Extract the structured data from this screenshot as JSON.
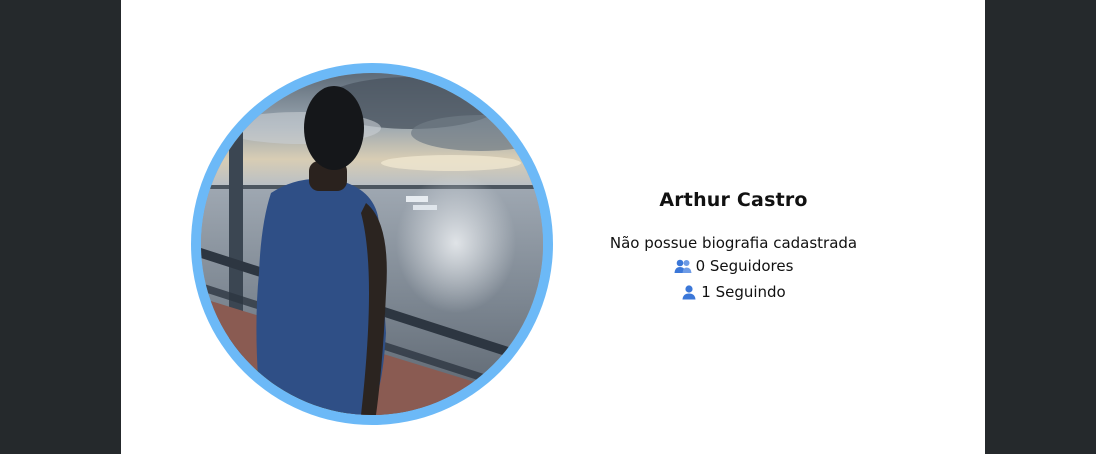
{
  "profile": {
    "name": "Arthur Castro",
    "bio": "Não possue biografia cadastrada",
    "followers": "0 Seguidores",
    "following": "1 Seguindo"
  },
  "icons": {
    "followers": "people-icon",
    "following": "person-icon"
  },
  "colors": {
    "avatar_ring": "#6cb9f7",
    "icon_blue": "#3b77d8",
    "side_background": "#25292c"
  }
}
